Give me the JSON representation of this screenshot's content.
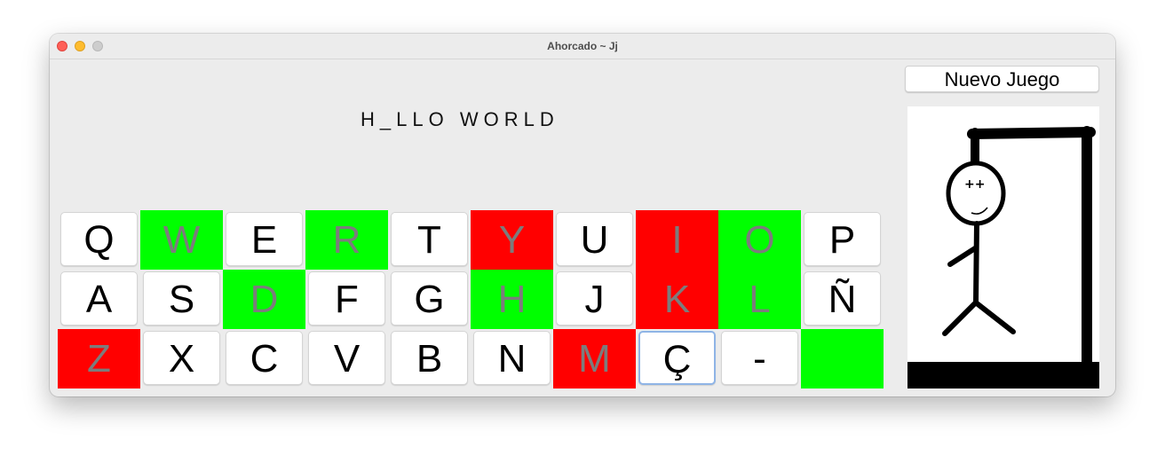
{
  "window": {
    "title": "Ahorcado ~ Jj"
  },
  "game": {
    "word_display": "H_LLO WORLD",
    "new_game_label": "Nuevo Juego"
  },
  "colors": {
    "hit": "#00ff00",
    "miss": "#ff0000",
    "used_text": "#7c7c7c"
  },
  "keyboard": {
    "rows": [
      [
        {
          "label": "Q",
          "state": "normal"
        },
        {
          "label": "W",
          "state": "hit"
        },
        {
          "label": "E",
          "state": "normal"
        },
        {
          "label": "R",
          "state": "hit"
        },
        {
          "label": "T",
          "state": "normal"
        },
        {
          "label": "Y",
          "state": "miss"
        },
        {
          "label": "U",
          "state": "normal"
        },
        {
          "label": "I",
          "state": "miss"
        },
        {
          "label": "O",
          "state": "hit"
        },
        {
          "label": "P",
          "state": "normal"
        }
      ],
      [
        {
          "label": "A",
          "state": "normal"
        },
        {
          "label": "S",
          "state": "normal"
        },
        {
          "label": "D",
          "state": "hit"
        },
        {
          "label": "F",
          "state": "normal"
        },
        {
          "label": "G",
          "state": "normal"
        },
        {
          "label": "H",
          "state": "hit"
        },
        {
          "label": "J",
          "state": "normal"
        },
        {
          "label": "K",
          "state": "miss"
        },
        {
          "label": "L",
          "state": "hit"
        },
        {
          "label": "Ñ",
          "state": "normal"
        }
      ],
      [
        {
          "label": "Z",
          "state": "miss"
        },
        {
          "label": "X",
          "state": "normal"
        },
        {
          "label": "C",
          "state": "normal"
        },
        {
          "label": "V",
          "state": "normal"
        },
        {
          "label": "B",
          "state": "normal"
        },
        {
          "label": "N",
          "state": "normal"
        },
        {
          "label": "M",
          "state": "miss"
        },
        {
          "label": "Ç",
          "state": "focused"
        },
        {
          "label": "-",
          "state": "normal"
        },
        {
          "label": "",
          "state": "hit"
        }
      ]
    ]
  }
}
